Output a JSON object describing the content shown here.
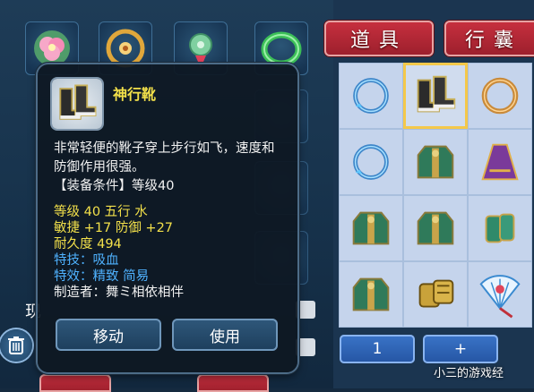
{
  "tabs": {
    "items_label": "道具",
    "bag_label": "行囊"
  },
  "equipment_slots": [
    {
      "name": "flower-ornament-icon"
    },
    {
      "name": "gold-amulet-icon"
    },
    {
      "name": "jade-pendant-icon"
    },
    {
      "name": "jade-bracelet-icon"
    }
  ],
  "left_panel": {
    "row_label": "现"
  },
  "tooltip": {
    "item_name": "神行靴",
    "description": "非常轻便的靴子穿上步行如飞，速度和防御作用很强。",
    "requirement": "【装备条件】等级40",
    "stats": [
      {
        "text": "等级 40  五行 水",
        "color": "#f2e04a"
      },
      {
        "text": "敏捷 +17 防御 +27",
        "color": "#f2e04a"
      },
      {
        "text": "耐久度 494",
        "color": "#f2e04a"
      },
      {
        "text": "特技：吸血",
        "color": "#4fb2ff"
      },
      {
        "text": "特效：精致 简易",
        "color": "#4fb2ff"
      },
      {
        "text": "制造者：舞ミ相依相伴",
        "color": "#f3f3f3"
      }
    ],
    "move_button": "移动",
    "use_button": "使用"
  },
  "bag": {
    "items": [
      {
        "name": "blue-ring-icon",
        "selected": false
      },
      {
        "name": "boots-icon",
        "selected": true
      },
      {
        "name": "bronze-ring-icon",
        "selected": false
      },
      {
        "name": "blue-ring-icon",
        "selected": false
      },
      {
        "name": "green-armor-icon",
        "selected": false
      },
      {
        "name": "purple-skirt-icon",
        "selected": false
      },
      {
        "name": "green-armor-icon",
        "selected": false
      },
      {
        "name": "green-armor-icon",
        "selected": false
      },
      {
        "name": "green-bracer-icon",
        "selected": false
      },
      {
        "name": "green-armor-icon",
        "selected": false
      },
      {
        "name": "gold-gauntlet-icon",
        "selected": false
      },
      {
        "name": "feather-fan-icon",
        "selected": false
      }
    ],
    "quantity": "1",
    "plus_label": "+"
  },
  "watermark": "小三的游戏经",
  "colors": {
    "tab_red": "#b52635",
    "selected_border": "#f4c84a",
    "stat_yellow": "#f2e04a",
    "special_blue": "#4fb2ff"
  }
}
